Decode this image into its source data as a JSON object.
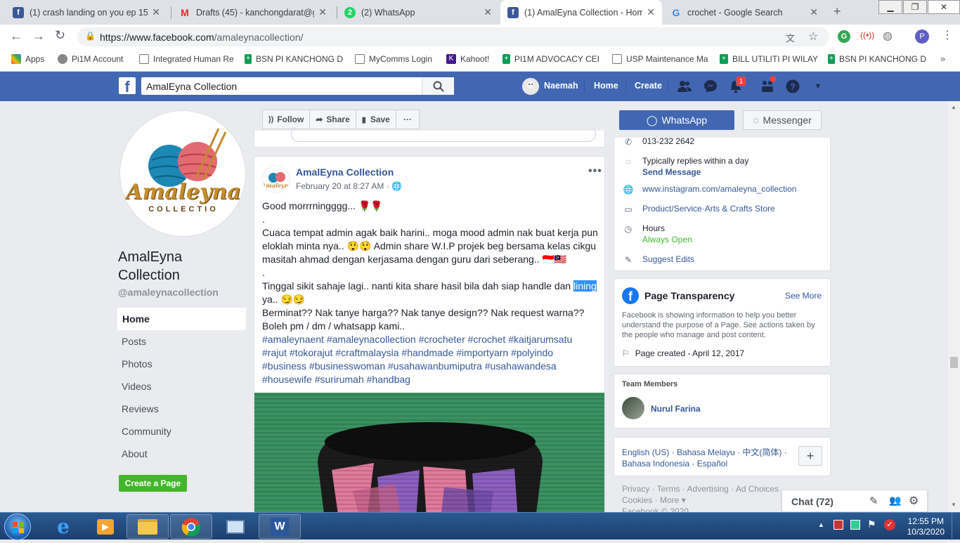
{
  "browser": {
    "tabs": [
      {
        "title": "(1) crash landing on you ep 15 -",
        "icon": "facebook-icon",
        "color": "#3b5998"
      },
      {
        "title": "Drafts (45) - kanchongdarat@gi",
        "icon": "gmail-icon",
        "color": "#d93025"
      },
      {
        "title": "(2) WhatsApp",
        "icon": "whatsapp-icon",
        "color": "#25d366"
      },
      {
        "title": "(1) AmalEyna Collection - Home",
        "icon": "facebook-icon",
        "color": "#3b5998",
        "active": true
      },
      {
        "title": "crochet - Google Search",
        "icon": "google-icon",
        "color": "#4285f4"
      }
    ],
    "url_host": "https://www.facebook.com",
    "url_path": "/amaleynacollection/",
    "bookmarks": [
      "Apps",
      "Pi1M Account",
      "Integrated Human Re",
      "BSN PI KANCHONG D",
      "MyComms Login",
      "Kahoot!",
      "PI1M ADVOCACY CEI",
      "USP Maintenance Ma",
      "BILL UTILITI PI WILAY",
      "BSN PI KANCHONG D"
    ]
  },
  "fb": {
    "search_value": "AmalEyna Collection",
    "user_name": "Naemah",
    "nav_home": "Home",
    "nav_create": "Create",
    "notification_count": "1",
    "brand_color": "#4267b2"
  },
  "page": {
    "name": "AmalEyna Collection",
    "handle": "@amaleynacollection",
    "logo_text": "Amaleyna",
    "logo_sub": "COLLECTIO",
    "nav": [
      "Home",
      "Posts",
      "Photos",
      "Videos",
      "Reviews",
      "Community",
      "About"
    ],
    "create_page": "Create a Page"
  },
  "actions": {
    "follow": "Follow",
    "share": "Share",
    "save": "Save",
    "more": "···",
    "whatsapp": "WhatsApp",
    "messenger": "Messenger"
  },
  "post": {
    "author": "AmalEyna Collection",
    "time": "February 20 at 8:27 AM ·",
    "line1": "Good morrrningggg... 🌹🌹",
    "dot1": ".",
    "para1": "Cuaca tempat admin agak baik harini.. moga mood admin nak buat kerja pun eloklah minta nya.. 😲😲 Admin share W.I.P projek beg bersama kelas cikgu masitah ahmad dengan kerjasama dengan guru dari seberang.. 🇮🇩🇲🇾",
    "dot2": ".",
    "para2_pre": "Tinggal sikit sahaje lagi.. nanti kita share hasil bila dah siap handle dan ",
    "para2_hl": "lining",
    "para2_post": " ya.. 😏😏",
    "para3": "Berminat?? Nak tanye harga?? Nak tanye design?? Nak request warna?? Boleh pm / dm / whatsapp kami..",
    "hashtags": "#amaleynaent #amaleynacollection #crocheter #crochet #kaitjarumsatu #rajut #tokorajut #craftmalaysia #handmade #importyarn #polyindo #business #businesswoman #usahawanbumiputra #usahawandesa #housewife #surirumah #handbag"
  },
  "info": {
    "phone": "013-232 2642",
    "reply": "Typically replies within a day",
    "send_message": "Send Message",
    "instagram": "www.instagram.com/amaleyna_collection",
    "category1": "Product/Service",
    "category_sep": " · ",
    "category2": "Arts & Crafts Store",
    "hours": "Hours",
    "hours_status": "Always Open",
    "suggest": "Suggest Edits"
  },
  "transparency": {
    "title": "Page Transparency",
    "see_more": "See More",
    "desc": "Facebook is showing information to help you better understand the purpose of a Page. See actions taken by the people who manage and post content.",
    "created": "Page created - April 12, 2017"
  },
  "team": {
    "title": "Team Members",
    "member": "Nurul Farina"
  },
  "languages": {
    "line1": "English (US) · Bahasa Melayu · 中文(简体) ·",
    "line2": "Bahasa Indonesia · Español"
  },
  "footer": {
    "line1": "Privacy · Terms · Advertising · Ad Choices",
    "line2": "Cookies · More ▾",
    "line3": "Facebook © 2020"
  },
  "chat": {
    "label": "Chat (72)"
  },
  "taskbar": {
    "time": "12:55 PM",
    "date": "10/3/2020"
  }
}
